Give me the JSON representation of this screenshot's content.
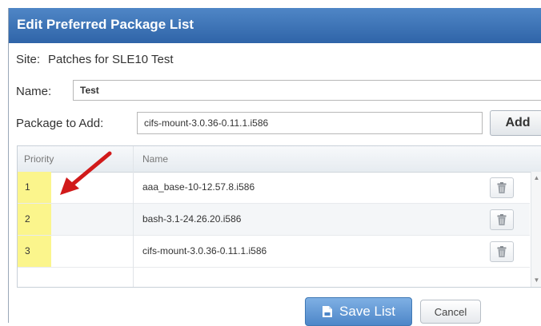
{
  "dialog": {
    "title": "Edit Preferred Package List"
  },
  "site": {
    "label": "Site:",
    "value": "Patches for SLE10 Test"
  },
  "name": {
    "label": "Name:",
    "value": "Test"
  },
  "package_to_add": {
    "label": "Package to Add:",
    "value": "cifs-mount-3.0.36-0.11.1.i586"
  },
  "buttons": {
    "add": "Add",
    "save_list": "Save List",
    "cancel": "Cancel"
  },
  "grid": {
    "columns": [
      "Priority",
      "Name"
    ],
    "rows": [
      {
        "priority": "1",
        "name": "aaa_base-10-12.57.8.i586"
      },
      {
        "priority": "2",
        "name": "bash-3.1-24.26.20.i586"
      },
      {
        "priority": "3",
        "name": "cifs-mount-3.0.36-0.11.1.i586"
      }
    ]
  },
  "colors": {
    "title_bar": "#3a72b8",
    "priority_highlight": "#fbf58c",
    "annotation_arrow": "#d11a1a",
    "save_button": "#5b92d0"
  },
  "icons": {
    "trash": "trash-icon",
    "save": "save-icon",
    "annotation": "red-arrow-annotation"
  }
}
